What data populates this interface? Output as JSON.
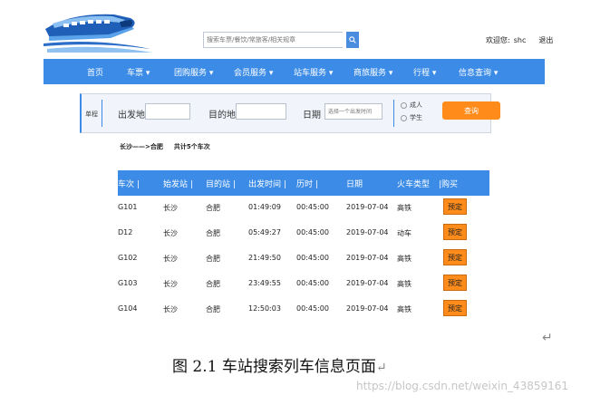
{
  "header": {
    "search": {
      "placeholder": "搜索车票/餐饮/常旅客/相关规章"
    },
    "welcome": "欢迎您:",
    "username": "shc",
    "logout": "退出"
  },
  "nav": [
    "首页",
    "车票 ▾",
    "团购服务 ▾",
    "会员服务 ▾",
    "站车服务 ▾",
    "商旅服务 ▾",
    "行程 ▾",
    "信息查询 ▾"
  ],
  "query": {
    "trip_type": "单程",
    "from_label": "出发地",
    "to_label": "目的地",
    "date_label": "日期",
    "date_placeholder": "选择一个出发时间",
    "passenger_adult": "成人",
    "passenger_student": "学生",
    "search_button": "查询"
  },
  "route": {
    "text": "长沙——>合肥",
    "count": "共计5个车次"
  },
  "table": {
    "headers": [
      "车次 |",
      "始发站 |",
      "目的站 |",
      "出发时间 |",
      "历时 |",
      "日期",
      "火车类型",
      "|购买"
    ],
    "book_label": "预定",
    "rows": [
      [
        "G101",
        "长沙",
        "合肥",
        "01:49:09",
        "00:45:00",
        "2019-07-04",
        "高铁"
      ],
      [
        "D12",
        "长沙",
        "合肥",
        "05:49:27",
        "00:45:00",
        "2019-07-04",
        "动车"
      ],
      [
        "G102",
        "长沙",
        "合肥",
        "21:49:50",
        "00:45:00",
        "2019-07-04",
        "高铁"
      ],
      [
        "G103",
        "长沙",
        "合肥",
        "23:49:55",
        "00:45:00",
        "2019-07-04",
        "高铁"
      ],
      [
        "G104",
        "长沙",
        "合肥",
        "12:50:03",
        "00:45:00",
        "2019-07-04",
        "高铁"
      ]
    ]
  },
  "caption": "图 2.1  车站搜索列车信息页面",
  "return_mark": "↵",
  "watermark": "https://blog.csdn.net/weixin_43859161",
  "colors": {
    "accent": "#3c8ce7",
    "button": "#ff8c1a"
  }
}
